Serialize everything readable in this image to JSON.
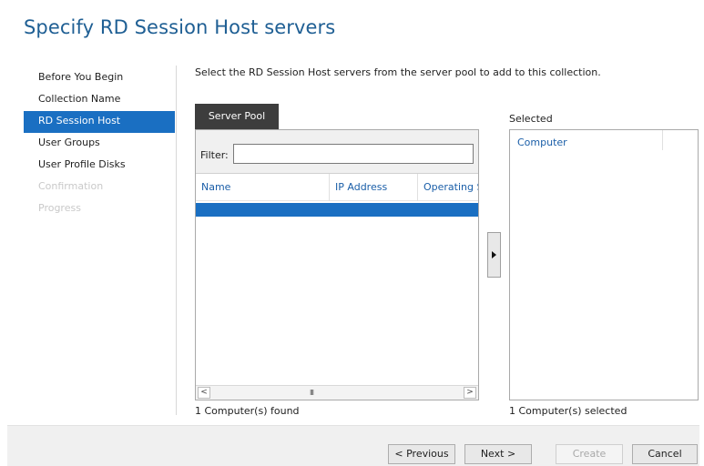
{
  "page": {
    "title": "Specify RD Session Host servers",
    "instruction": "Select the RD Session Host servers from the server pool to add to this collection."
  },
  "nav": {
    "items": [
      {
        "label": "Before You Begin",
        "state": "normal"
      },
      {
        "label": "Collection Name",
        "state": "normal"
      },
      {
        "label": "RD Session Host",
        "state": "active"
      },
      {
        "label": "User Groups",
        "state": "normal"
      },
      {
        "label": "User Profile Disks",
        "state": "normal"
      },
      {
        "label": "Confirmation",
        "state": "disabled"
      },
      {
        "label": "Progress",
        "state": "disabled"
      }
    ]
  },
  "server_pool": {
    "tab_label": "Server Pool",
    "filter_label": "Filter:",
    "filter_value": "",
    "columns": [
      "Name",
      "IP Address",
      "Operating S"
    ],
    "scroll_left": "<",
    "scroll_thumb": "III",
    "scroll_right": ">",
    "status": "1 Computer(s) found"
  },
  "add_button": {
    "icon": "play-right-icon"
  },
  "selected": {
    "label": "Selected",
    "column": "Computer",
    "status": "1 Computer(s) selected"
  },
  "footer": {
    "previous": "< Previous",
    "next": "Next >",
    "create": "Create",
    "cancel": "Cancel"
  },
  "colors": {
    "accent": "#1a6fc2",
    "title": "#1f5f94",
    "tab_bg": "#3d3d3d",
    "link": "#1a5ea8"
  }
}
